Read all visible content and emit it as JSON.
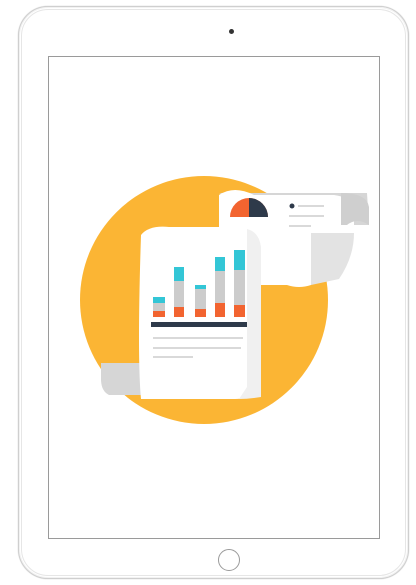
{
  "device": {
    "type": "tablet",
    "orientation": "portrait"
  },
  "illustration": {
    "subject": "report-document-icon",
    "colors": {
      "circle": "#FBB534",
      "paper": "#FFFFFF",
      "paper_fold": "#D6D6D6",
      "bar_base": "#CCCCCC",
      "bar_top": "#33C6D6",
      "bar_bottom": "#F26430",
      "axis_line": "#2E3A4A",
      "pie_main": "#F26430",
      "pie_dark": "#2E3A4A",
      "pie_light": "#33C6D6",
      "text_lines": "#D9D9D9"
    }
  }
}
